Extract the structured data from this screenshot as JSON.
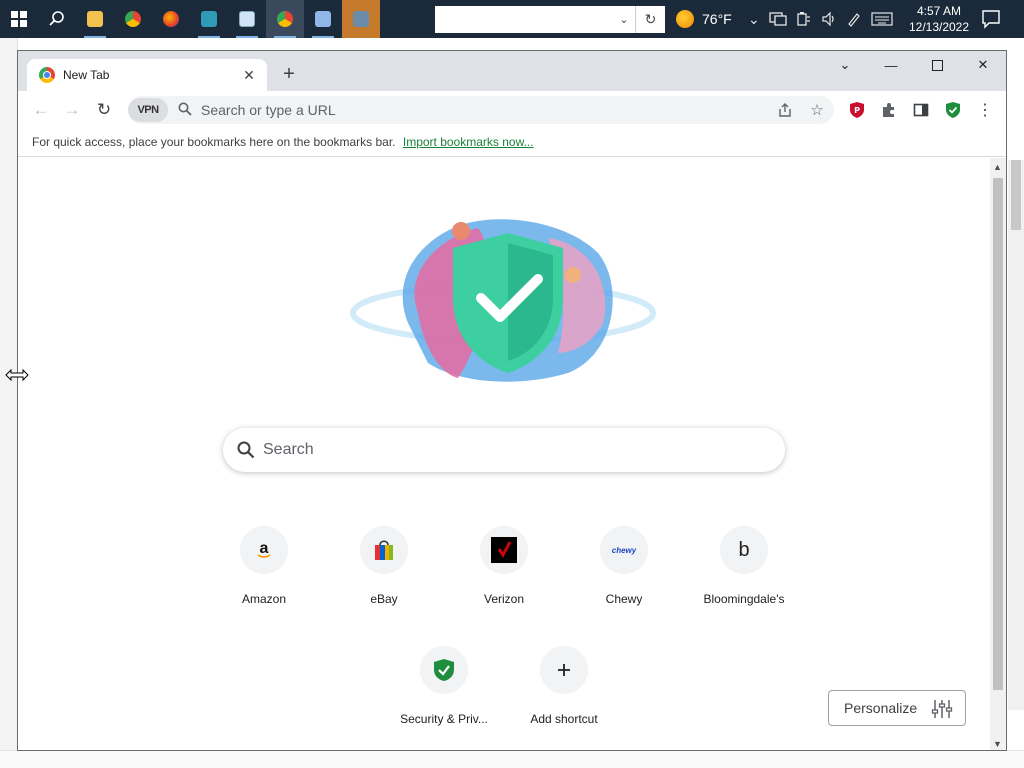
{
  "taskbar": {
    "weather": {
      "temp": "76°F"
    },
    "clock": {
      "time": "4:57 AM",
      "date": "12/13/2022"
    }
  },
  "browser": {
    "tab_title": "New Tab",
    "omnibox_placeholder": "Search or type a URL",
    "vpn_label": "VPN",
    "bookmarks_bar": {
      "text": "For quick access, place your bookmarks here on the bookmarks bar.",
      "link": "Import bookmarks now..."
    }
  },
  "ntp": {
    "search_placeholder": "Search",
    "shortcuts": [
      {
        "label": "Amazon",
        "icon": "amazon-icon"
      },
      {
        "label": "eBay",
        "icon": "ebay-bag-icon"
      },
      {
        "label": "Verizon",
        "icon": "verizon-check-icon"
      },
      {
        "label": "Chewy",
        "icon": "chewy-logo-icon"
      },
      {
        "label": "Bloomingdale's",
        "icon": "letter-b-icon"
      },
      {
        "label": "Security & Priv...",
        "icon": "shield-check-icon"
      },
      {
        "label": "Add shortcut",
        "icon": "plus-icon"
      }
    ],
    "personalize_label": "Personalize"
  },
  "colors": {
    "taskbar": "#1b2a3a",
    "tabstrip": "#dee1e6",
    "link_green": "#188038"
  }
}
